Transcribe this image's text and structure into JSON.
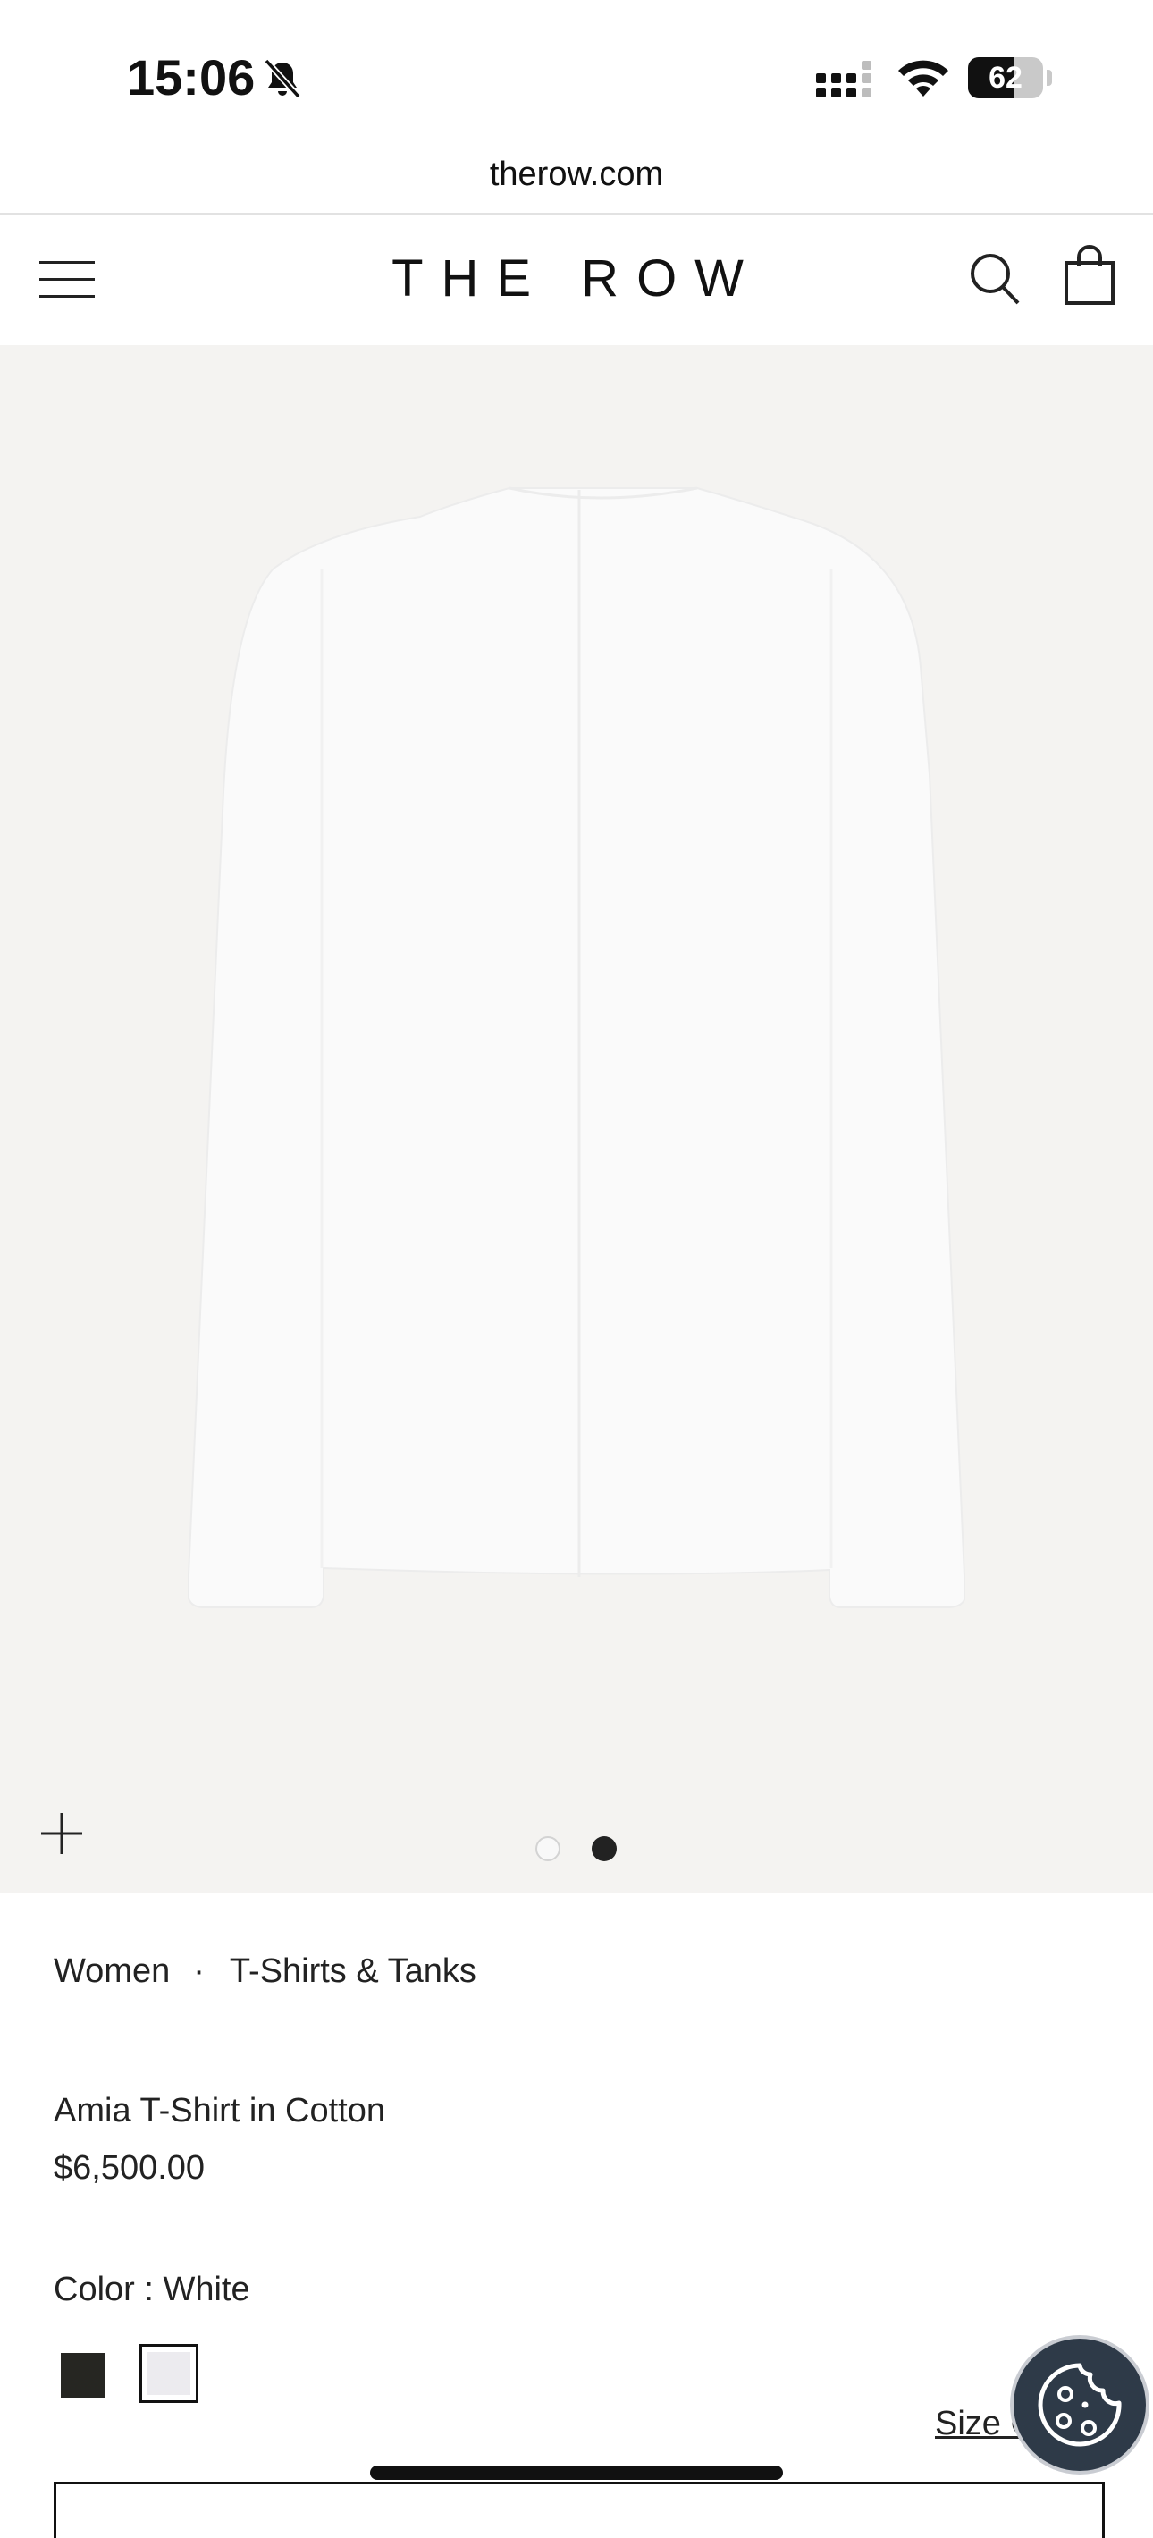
{
  "status_bar": {
    "time": "15:06",
    "battery": "62",
    "battery_level": 0.62,
    "icons": [
      "bell-slash-icon",
      "cellular-signal-icon",
      "wifi-icon",
      "battery-icon"
    ]
  },
  "browser": {
    "url": "therow.com"
  },
  "header": {
    "logo": "THE ROW",
    "icons": [
      "hamburger-menu-icon",
      "search-icon",
      "shopping-bag-icon"
    ]
  },
  "gallery": {
    "image_alt": "white long-sleeve t-shirt, back view",
    "image_count": 2,
    "active_index": 2,
    "background_color": "#f4f3f1",
    "zoom_icon": "plus-icon"
  },
  "breadcrumb": {
    "items": [
      "Women",
      "T-Shirts & Tanks"
    ],
    "separator": "·"
  },
  "product": {
    "name": "Amia T-Shirt in Cotton",
    "price": "$6,500.00"
  },
  "color": {
    "label": "Color : White",
    "options": [
      {
        "name": "Black",
        "hex": "#262622",
        "selected": false
      },
      {
        "name": "White",
        "hex": "#ecebef",
        "selected": true
      }
    ]
  },
  "size_guide": {
    "label": "Size C"
  },
  "cookie_button": {
    "icon": "cookie-icon",
    "color": "#2e3a48"
  }
}
